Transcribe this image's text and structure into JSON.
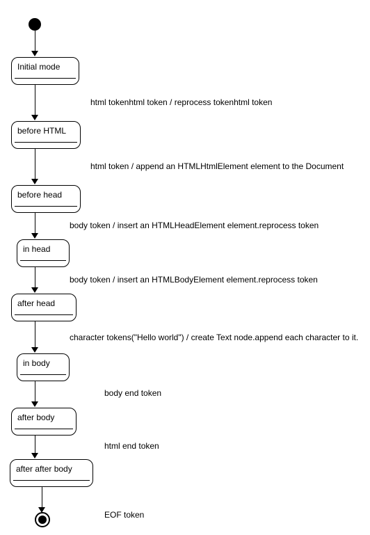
{
  "chart_data": {
    "type": "state-machine",
    "title": "",
    "states": [
      {
        "id": "start",
        "kind": "initial",
        "label": ""
      },
      {
        "id": "initial_mode",
        "kind": "state",
        "label": "Initial mode"
      },
      {
        "id": "before_html",
        "kind": "state",
        "label": "before HTML"
      },
      {
        "id": "before_head",
        "kind": "state",
        "label": "before head"
      },
      {
        "id": "in_head",
        "kind": "state",
        "label": "in head"
      },
      {
        "id": "after_head",
        "kind": "state",
        "label": "after head"
      },
      {
        "id": "in_body",
        "kind": "state",
        "label": "in body"
      },
      {
        "id": "after_body",
        "kind": "state",
        "label": "after body"
      },
      {
        "id": "after_after_body",
        "kind": "state",
        "label": "after after body"
      },
      {
        "id": "end",
        "kind": "final",
        "label": ""
      }
    ],
    "transitions": [
      {
        "from": "start",
        "to": "initial_mode",
        "label": ""
      },
      {
        "from": "initial_mode",
        "to": "before_html",
        "label": "html tokenhtml token / reprocess tokenhtml token"
      },
      {
        "from": "before_html",
        "to": "before_head",
        "label": "html token / append an HTMLHtmlElement element to the Document"
      },
      {
        "from": "before_head",
        "to": "in_head",
        "label": "body token / insert an HTMLHeadElement element.reprocess token"
      },
      {
        "from": "in_head",
        "to": "after_head",
        "label": "body token / insert an HTMLBodyElement element.reprocess token"
      },
      {
        "from": "after_head",
        "to": "in_body",
        "label": "character tokens(\"Hello world\") / create Text node.append each character to it."
      },
      {
        "from": "in_body",
        "to": "after_body",
        "label": "body end token"
      },
      {
        "from": "after_body",
        "to": "after_after_body",
        "label": "html end token"
      },
      {
        "from": "after_after_body",
        "to": "end",
        "label": "EOF token"
      }
    ]
  },
  "states": {
    "initial_mode": {
      "label": "Initial mode"
    },
    "before_html": {
      "label": "before HTML"
    },
    "before_head": {
      "label": "before head"
    },
    "in_head": {
      "label": "in head"
    },
    "after_head": {
      "label": "after head"
    },
    "in_body": {
      "label": "in body"
    },
    "after_body": {
      "label": "after body"
    },
    "after_after_body": {
      "label": "after after body"
    }
  },
  "edges": {
    "e0": "",
    "e1": "html tokenhtml token / reprocess tokenhtml token",
    "e2": "html token / append an HTMLHtmlElement element to the Document",
    "e3": "body token / insert an HTMLHeadElement element.reprocess token",
    "e4": "body token / insert an HTMLBodyElement element.reprocess token",
    "e5": "character tokens(\"Hello world\") / create Text node.append each character to it.",
    "e6": "body end token",
    "e7": "html end token",
    "e8": "EOF token"
  }
}
